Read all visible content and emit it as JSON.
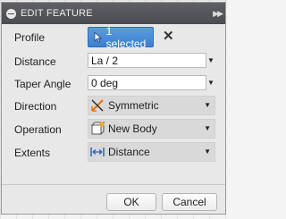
{
  "dialog": {
    "title": "EDIT FEATURE",
    "header_icons": {
      "collapse": "minus-circle-icon",
      "expand": "double-chevron-right-icon"
    }
  },
  "fields": {
    "profile": {
      "label": "Profile",
      "button_label": "1 selected",
      "icon": "cursor-arrow-icon",
      "clear_icon": "close-x-icon"
    },
    "distance": {
      "label": "Distance",
      "value": "La / 2"
    },
    "taper_angle": {
      "label": "Taper Angle",
      "value": "0 deg"
    },
    "direction": {
      "label": "Direction",
      "value": "Symmetric",
      "icon": "symmetric-direction-icon"
    },
    "operation": {
      "label": "Operation",
      "value": "New Body",
      "icon": "new-body-icon"
    },
    "extents": {
      "label": "Extents",
      "value": "Distance",
      "icon": "distance-arrows-icon"
    }
  },
  "buttons": {
    "ok": "OK",
    "cancel": "Cancel"
  },
  "colors": {
    "header_bg": "#4f5054",
    "accent_blue": "#3c7fcf",
    "panel_bg": "#e8e8e8"
  }
}
